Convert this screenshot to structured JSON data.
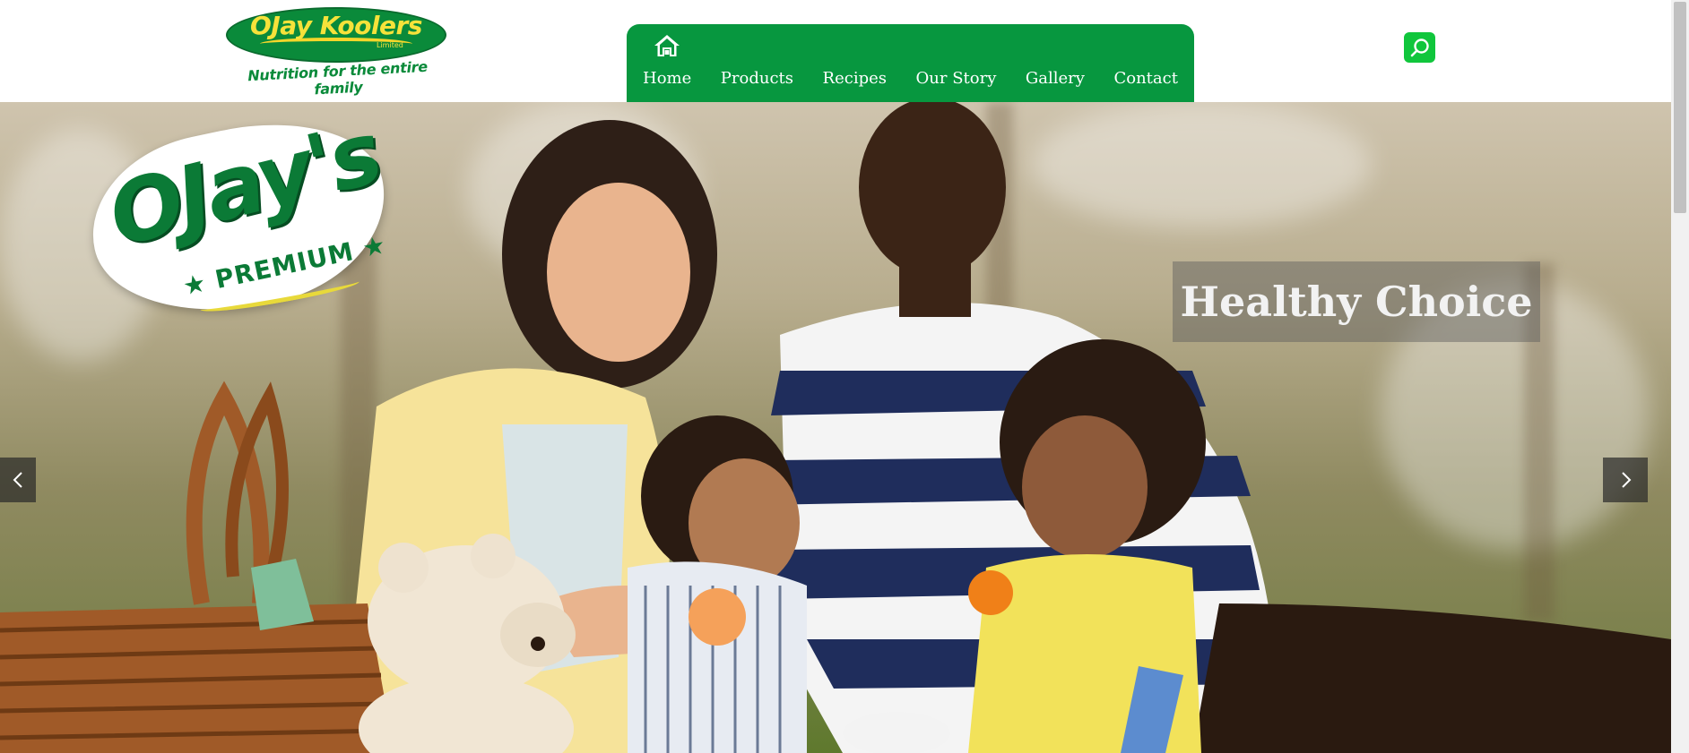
{
  "brand": {
    "name": "OJay Koolers",
    "limited": "Limited",
    "tagline": "Nutrition for the entire family"
  },
  "nav": {
    "items": [
      {
        "label": "Home",
        "icon": "home-icon"
      },
      {
        "label": "Products"
      },
      {
        "label": "Recipes"
      },
      {
        "label": "Our Story"
      },
      {
        "label": "Gallery"
      },
      {
        "label": "Contact"
      }
    ]
  },
  "search": {
    "icon": "search-icon",
    "color": "#10c63c"
  },
  "hero": {
    "badge_title": "OJay's",
    "badge_subtitle": "★ PREMIUM ★",
    "caption": "Healthy Choice",
    "prev_icon": "chevron-left-icon",
    "next_icon": "chevron-right-icon"
  },
  "colors": {
    "nav_bg": "#07973f",
    "brand_green": "#0a8a3a",
    "brand_yellow": "#f6e23a"
  }
}
